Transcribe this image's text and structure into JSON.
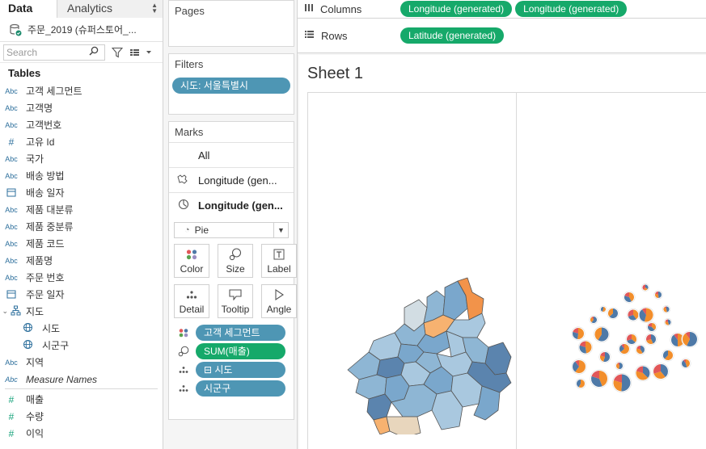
{
  "data_pane": {
    "tabs": [
      "Data",
      "Analytics"
    ],
    "datasource": "주문_2019 (슈퍼스토어_...",
    "search": {
      "placeholder": "Search"
    },
    "tables_header": "Tables",
    "fields": [
      {
        "type": "Abc",
        "name": "고객 세그먼트"
      },
      {
        "type": "Abc",
        "name": "고객명"
      },
      {
        "type": "Abc",
        "name": "고객번호"
      },
      {
        "type": "#",
        "name": "고유 Id"
      },
      {
        "type": "Abc",
        "name": "국가"
      },
      {
        "type": "Abc",
        "name": "배송 방법"
      },
      {
        "type": "date",
        "name": "배송 일자"
      },
      {
        "type": "Abc",
        "name": "제품 대분류"
      },
      {
        "type": "Abc",
        "name": "제품 중분류"
      },
      {
        "type": "Abc",
        "name": "제품 코드"
      },
      {
        "type": "Abc",
        "name": "제품명"
      },
      {
        "type": "Abc",
        "name": "주문 번호"
      },
      {
        "type": "date",
        "name": "주문 일자"
      },
      {
        "type": "hier",
        "name": "지도"
      },
      {
        "type": "geo",
        "name": "시도",
        "child": true
      },
      {
        "type": "geo",
        "name": "시군구",
        "child": true
      },
      {
        "type": "Abc",
        "name": "지역"
      },
      {
        "type": "Abc",
        "name": "Measure Names",
        "italic": true
      },
      {
        "type": "#m",
        "name": "매출"
      },
      {
        "type": "#m",
        "name": "수량"
      },
      {
        "type": "#m",
        "name": "이익"
      }
    ]
  },
  "cards": {
    "pages_title": "Pages",
    "filters_title": "Filters",
    "filter_pill": "시도: 서울특별시",
    "marks_title": "Marks",
    "marks_all": "All",
    "marks_layer1": "Longitude (gen...",
    "marks_layer2": "Longitude (gen...",
    "mark_type": "Pie",
    "shelf_buttons": [
      "Color",
      "Size",
      "Label",
      "Detail",
      "Tooltip",
      "Angle"
    ],
    "mark_pills": [
      {
        "icon": "color",
        "label": "고객 세그먼트",
        "kind": "dim"
      },
      {
        "icon": "size",
        "label": "SUM(매출)",
        "kind": "meas"
      },
      {
        "icon": "detail",
        "label": "⊟ 시도",
        "kind": "dim"
      },
      {
        "icon": "detail",
        "label": "시군구",
        "kind": "dim"
      }
    ]
  },
  "shelves": {
    "columns_label": "Columns",
    "columns_pills": [
      "Longitude (generated)",
      "Longitude (generated)"
    ],
    "rows_label": "Rows",
    "rows_pills": [
      "Latitude (generated)"
    ]
  },
  "sheet": {
    "title": "Sheet 1"
  },
  "colors": {
    "dimension_pill": "#4e96b4",
    "measure_pill": "#16a96a",
    "segment_blue": "#4e79a7",
    "segment_orange": "#f28e2b",
    "segment_red": "#e15759"
  }
}
